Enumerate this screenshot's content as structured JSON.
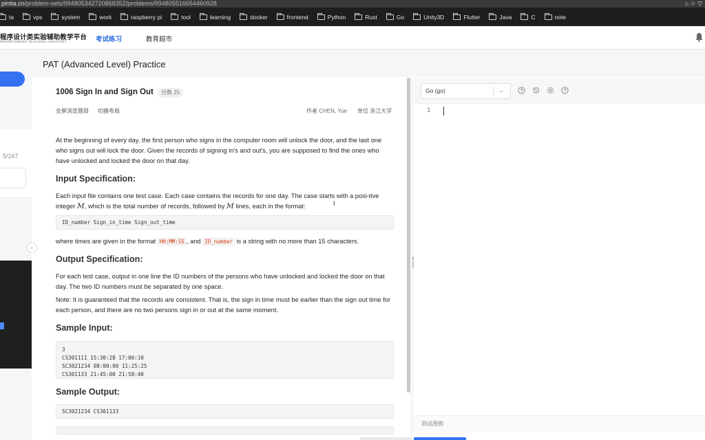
{
  "browser": {
    "url_host": "pintia.cn",
    "url_path": "/problem-sets/994805342720868352/problems/994805516654460928",
    "bookmarks": [
      "vps",
      "system",
      "work",
      "raspberry pi",
      "tool",
      "learning",
      "docker",
      "frontend",
      "Python",
      "Rust",
      "Go",
      "Unity3D",
      "Flutter",
      "Java",
      "C",
      "note"
    ]
  },
  "site": {
    "logo_main": "程序设计类实验辅助教学平台",
    "logo_sub": "PROGRAMMING TEACHING ASSISTANT",
    "nav": [
      "考试练习",
      "教育超市"
    ]
  },
  "page": {
    "title": "PAT (Advanced Level) Practice"
  },
  "sidebar": {
    "count": "5/167"
  },
  "problem": {
    "title": "1006 Sign In and Sign Out",
    "score_badge": "分数 25",
    "toolbar": [
      "全屏浏览题目",
      "切换布局"
    ],
    "author": "作者 CHEN, Yue",
    "unit": "单位 浙江大学",
    "intro": "At the beginning of every day, the first person who signs in the computer room will unlock the door, and the last one who signs out will lock the door. Given the records of signing in's and out's, you are supposed to find the ones who have unlocked and locked the door on that day.",
    "input_heading": "Input Specification:",
    "input_p1_a": "Each input file contains one test case. Each case contains the records for one day. The case starts with a posi-tive integer ",
    "input_p1_m1": "M",
    "input_p1_b": ", which is the total number of records, followed by ",
    "input_p1_m2": "M",
    "input_p1_c": " lines, each in the format:",
    "format_code": "ID_number Sign_in_time Sign_out_time",
    "where_a": "where times are given in the format ",
    "where_code1": "HH:MM:SS",
    "where_b": ", and ",
    "where_code2": "ID_number",
    "where_c": " is a string with no more than 15 characters.",
    "output_heading": "Output Specification:",
    "output_p1": "For each test case, output in one line the ID numbers of the persons who have unlocked and locked the door on that day. The two ID numbers must be separated by one space.",
    "output_note": "Note: It is guaranteed that the records are consistent. That is, the sign in time must be earlier than the sign out time for each person, and there are no two persons sign in or out at the same moment.",
    "sample_input_heading": "Sample Input:",
    "sample_input": "3\nCS301111 15:30:28 17:00:10\nSC3021234 08:00:00 11:25:25\nCS301133 21:45:00 21:58:40",
    "sample_output_heading": "Sample Output:",
    "sample_output": "SC3021234 CS301133"
  },
  "editor": {
    "language": "Go (go)",
    "line_number": "1",
    "testcase_label": "测试用例"
  },
  "icons": [
    "folder-icon",
    "bell-icon",
    "help-icon",
    "history-icon",
    "settings-icon",
    "info-icon",
    "chevron-down-icon"
  ],
  "colors": {
    "accent": "#3572f2",
    "nav_active": "#2f6fde",
    "inline_code": "#d4380d"
  }
}
